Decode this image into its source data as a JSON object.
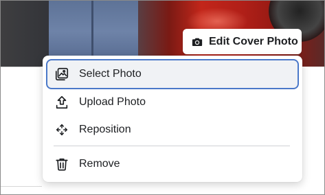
{
  "cover": {
    "edit_button_label": "Edit Cover Photo",
    "edit_button_icon": "camera-icon"
  },
  "menu": {
    "items": [
      {
        "label": "Select Photo",
        "icon": "photo-album-icon",
        "selected": true
      },
      {
        "label": "Upload Photo",
        "icon": "upload-icon",
        "selected": false
      },
      {
        "label": "Reposition",
        "icon": "move-arrows-icon",
        "selected": false
      },
      {
        "label": "Remove",
        "icon": "trash-icon",
        "selected": false
      }
    ]
  },
  "colors": {
    "focus_ring": "#4a78c9",
    "selected_bg": "#f0f2f5",
    "text": "#1c1e21"
  }
}
